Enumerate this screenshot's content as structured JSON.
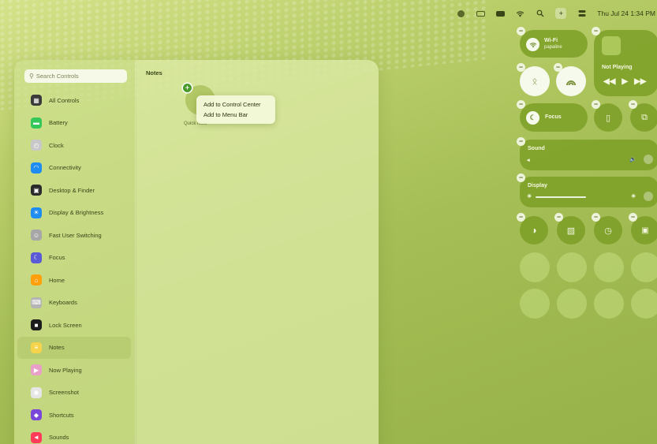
{
  "menubar": {
    "items": [
      "record-icon",
      "display-icon",
      "battery-icon",
      "wifi-icon",
      "search-icon",
      "add-icon",
      "control-center-icon"
    ],
    "clock": "Thu Jul 24 1:34 PM"
  },
  "sidebar": {
    "search_placeholder": "Search Controls",
    "items": [
      {
        "label": "All Controls",
        "icon": "grid-icon",
        "color": "#3a3a3a"
      },
      {
        "label": "Battery",
        "icon": "battery-icon",
        "color": "#34c759"
      },
      {
        "label": "Clock",
        "icon": "clock-icon",
        "color": "#c8c8c8"
      },
      {
        "label": "Connectivity",
        "icon": "wifi-icon",
        "color": "#1e8cf0"
      },
      {
        "label": "Desktop & Finder",
        "icon": "desktop-icon",
        "color": "#2b2b2b"
      },
      {
        "label": "Display & Brightness",
        "icon": "brightness-icon",
        "color": "#1e8cf0"
      },
      {
        "label": "Fast User Switching",
        "icon": "user-icon",
        "color": "#a7a7a7"
      },
      {
        "label": "Focus",
        "icon": "moon-icon",
        "color": "#5a5ad6"
      },
      {
        "label": "Home",
        "icon": "home-icon",
        "color": "#ff9f0a"
      },
      {
        "label": "Keyboards",
        "icon": "keyboard-icon",
        "color": "#b4b4b4"
      },
      {
        "label": "Lock Screen",
        "icon": "lock-icon",
        "color": "#1c1c1c"
      },
      {
        "label": "Notes",
        "icon": "notes-icon",
        "color": "#f5d34a"
      },
      {
        "label": "Now Playing",
        "icon": "play-icon",
        "color": "#e9a0c8"
      },
      {
        "label": "Screenshot",
        "icon": "camera-icon",
        "color": "#e6e6e6"
      },
      {
        "label": "Shortcuts",
        "icon": "shortcuts-icon",
        "color": "#7a47d8"
      },
      {
        "label": "Sounds",
        "icon": "speaker-icon",
        "color": "#ff3b5a"
      }
    ],
    "active_index": 11
  },
  "content": {
    "title": "Notes",
    "tile_label": "Quick Note",
    "popup": [
      "Add to Control Center",
      "Add to Menu Bar"
    ]
  },
  "control_center": {
    "wifi": {
      "title": "Wi-Fi",
      "network": "papaline"
    },
    "now_playing": {
      "title": "Not Playing"
    },
    "focus": {
      "label": "Focus"
    },
    "sound": {
      "label": "Sound",
      "level": 0.0
    },
    "display": {
      "label": "Display",
      "level": 0.58
    }
  }
}
